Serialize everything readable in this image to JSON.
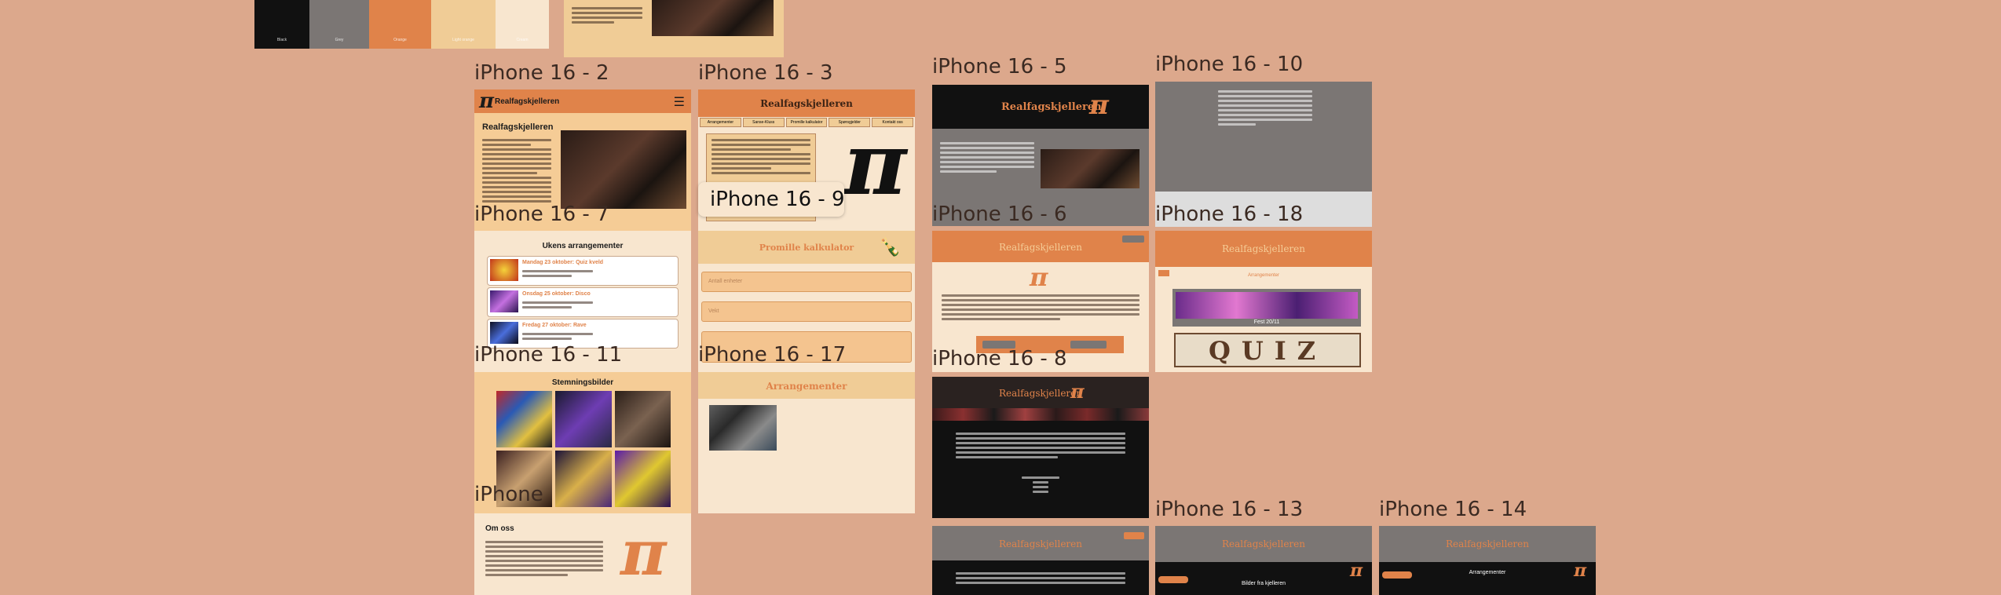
{
  "palette": {
    "swatches": [
      {
        "color": "#111111",
        "hex": "#000000",
        "name": "Black"
      },
      {
        "color": "#7B7674",
        "hex": "#7C7C7C",
        "name": "Grey"
      },
      {
        "color": "#E0834A",
        "hex": "#E0834A",
        "name": "Orange"
      },
      {
        "color": "#F0CC96",
        "hex": "#F5CC96",
        "name": "Light orange"
      },
      {
        "color": "#F8E6CF",
        "hex": "#FAE6CF",
        "name": "Cream"
      }
    ]
  },
  "frame_labels": {
    "f2": "iPhone 16 - 2",
    "f3": "iPhone 16 - 3",
    "f5": "iPhone 16 - 5",
    "f10": "iPhone 16 - 10",
    "f7": "iPhone 16 - 7",
    "f9": "iPhone 16 - 9",
    "f6": "iPhone 16 - 6",
    "f18": "iPhone 16 - 18",
    "f11": "iPhone 16 - 11",
    "f17": "iPhone 16 - 17",
    "f8": "iPhone 16 - 8",
    "f1": "iPhone",
    "f13": "iPhone 16 - 13",
    "f14": "iPhone 16 - 14"
  },
  "site": {
    "name": "Realfagskjelleren",
    "pi": "π",
    "section_title": "Realfagskjelleren",
    "nav_tabs": [
      "Arrangementer",
      "Sanse-Kluss",
      "Promille kalkulator",
      "Spørsgjelder",
      "Kontakt oss"
    ],
    "events_heading": "Ukens arrangementer",
    "events": [
      {
        "title": "Mandag 23 oktober: Quiz kveld"
      },
      {
        "title": "Onsdag 25 oktober: Disco"
      },
      {
        "title": "Fredag 27 oktober: Rave"
      }
    ],
    "mood_heading": "Stemningsbilder",
    "about_heading": "Om oss",
    "calc_heading": "Promille kalkulator",
    "calc_inputs": [
      "Antall enheter",
      "Vekt",
      ""
    ],
    "arr_heading": "Arrangementer",
    "fest_label": "Fest 20/11",
    "quiz_label": "QUIZ",
    "arr_small": "Arrangementer",
    "bilder_label": "Bilder fra kjelleren"
  }
}
